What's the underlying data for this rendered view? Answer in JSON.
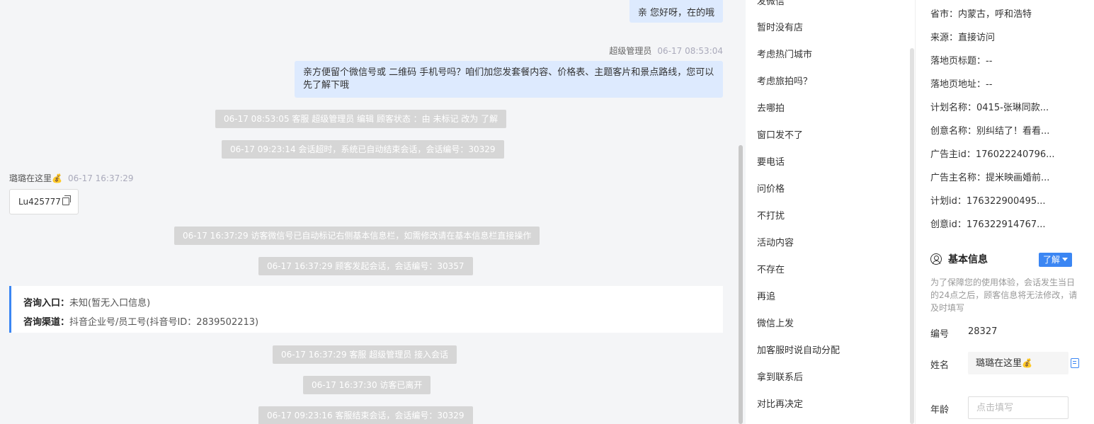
{
  "chat": {
    "top_partial": "亲 您好呀，在的哦",
    "agent_name": "超级管理员",
    "agent_time": "06-17 08:53:04",
    "agent_msg_line1": "亲方便留个微信号或 二维码 手机号吗？咱们加您发套餐内容、价格表、主题客片和景点路线，您可以",
    "agent_msg_line2": "先了解下哦",
    "sys1": "06-17 08:53:05 客服 超级管理员 编辑 顾客状态 ：由 未标记 改为 了解",
    "sys2": "06-17 09:23:14 会话超时，系统已自动结束会话，会话编号：30329",
    "visitor_name": "璐璐在这里",
    "visitor_emoji": "💰",
    "visitor_time": "06-17 16:37:29",
    "visitor_msg": "Lu425777",
    "sys3": "06-17 16:37:29 访客微信号已自动标记右侧基本信息栏，如需修改请在基本信息栏直接操作",
    "sys4": "06-17 16:37:29 顾客发起会话，会话编号：30357",
    "entry_label": "咨询入口：",
    "entry_value": "未知(暂无入口信息)",
    "channel_label": "咨询渠道：",
    "channel_value": "抖音企业号/员工号(抖音号ID：2839502213)",
    "sys5": "06-17 16:37:29 客服 超级管理员 接入会话",
    "sys6": "06-17 16:37:30 访客已离开",
    "sys7": "06-17 09:23:16 客服结束会话，会话编号：30329"
  },
  "quick_replies": [
    "发微信",
    "暂时没有店",
    "考虑热门城市",
    "考虑旅拍吗？",
    "去哪拍",
    "窗口发不了",
    "要电话",
    "问价格",
    "不打扰",
    "活动内容",
    "不存在",
    "再追",
    "微信上发",
    "加客服时说自动分配",
    "拿到联系后",
    "对比再决定"
  ],
  "side": {
    "rows": [
      {
        "label": "省市：",
        "value": "内蒙古，呼和浩特"
      },
      {
        "label": "来源：",
        "value": "直接访问"
      },
      {
        "label": "落地页标题：",
        "value": "--"
      },
      {
        "label": "落地页地址：",
        "value": "--"
      },
      {
        "label": "计划名称：",
        "value": "0415-张琳同款..."
      },
      {
        "label": "创意名称：",
        "value": "别纠结了！看看..."
      },
      {
        "label": "广告主id：",
        "value": "176022240796..."
      },
      {
        "label": "广告主名称：",
        "value": "提米映画婚前..."
      },
      {
        "label": "计划id：",
        "value": "176322900495..."
      },
      {
        "label": "创意id：",
        "value": "176322914767..."
      }
    ],
    "section_title": "基本信息",
    "status_button": "了解",
    "note": "为了保障您的使用体验，会话发生当日的24点之后，顾客信息将无法修改，请及时填写",
    "id_label": "编号",
    "id_value": "28327",
    "name_label": "姓名",
    "name_value": "璐璐在这里",
    "name_emoji": "💰",
    "age_label": "年龄",
    "age_placeholder": "点击填写"
  },
  "colors": {
    "accent": "#3b86f3",
    "out_bubble": "#ddeafe",
    "system_pill": "#d6d6d6",
    "chat_bg": "#f4f5f7"
  },
  "icons": [
    "copy-icon",
    "user-circle-icon",
    "caret-down-icon",
    "copy-blue-icon"
  ]
}
